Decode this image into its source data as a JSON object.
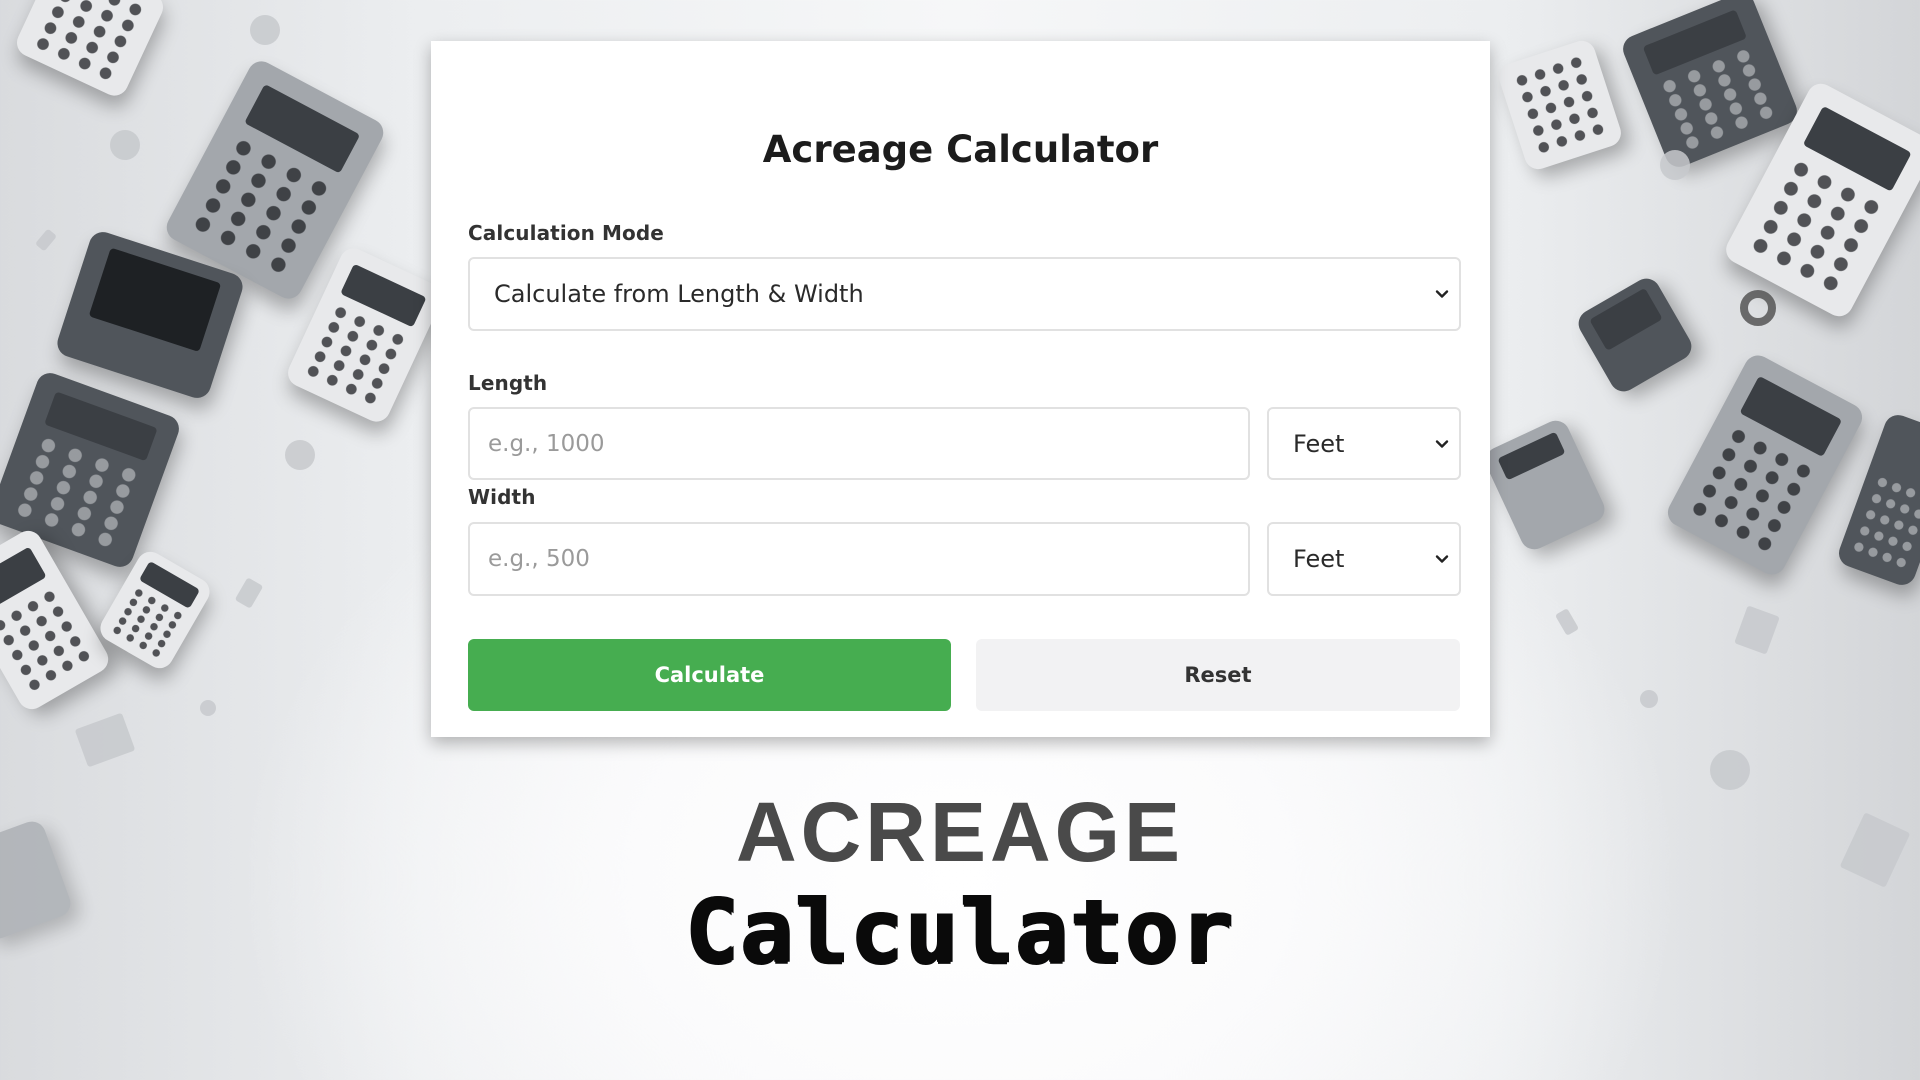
{
  "card": {
    "title": "Acreage Calculator",
    "mode_label": "Calculation Mode",
    "mode_value": "Calculate from Length & Width",
    "length_label": "Length",
    "length_placeholder": "e.g., 1000",
    "length_unit": "Feet",
    "width_label": "Width",
    "width_placeholder": "e.g., 500",
    "width_unit": "Feet",
    "calculate_label": "Calculate",
    "reset_label": "Reset"
  },
  "banner": {
    "line1": "ACREAGE",
    "line2": "Calculator"
  },
  "colors": {
    "accent_green": "#46ad50",
    "reset_bg": "#f2f2f3"
  },
  "icons": {
    "dropdown": "chevron-down-icon"
  }
}
